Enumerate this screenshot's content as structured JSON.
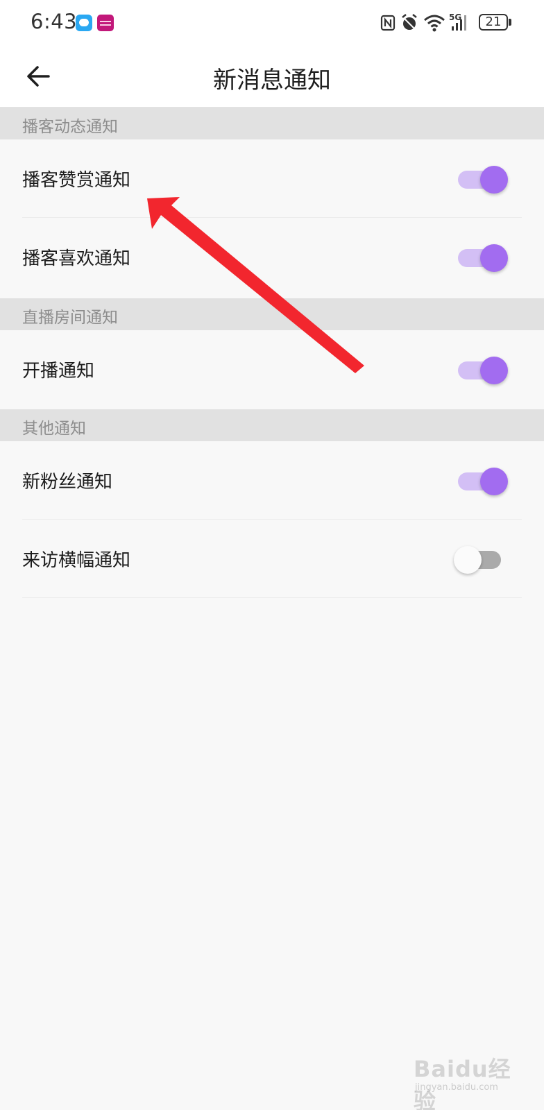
{
  "status_bar": {
    "time": "6:43",
    "network": "5G",
    "battery": "21"
  },
  "header": {
    "title": "新消息通知"
  },
  "sections": [
    {
      "title": "播客动态通知",
      "items": [
        {
          "label": "播客赞赏通知",
          "enabled": true
        },
        {
          "label": "播客喜欢通知",
          "enabled": true
        }
      ]
    },
    {
      "title": "直播房间通知",
      "items": [
        {
          "label": "开播通知",
          "enabled": true
        }
      ]
    },
    {
      "title": "其他通知",
      "items": [
        {
          "label": "新粉丝通知",
          "enabled": true
        },
        {
          "label": "来访横幅通知",
          "enabled": false
        }
      ]
    }
  ],
  "colors": {
    "accent": "#a26cf0",
    "accent_track": "#d3bff5",
    "off_track": "#aaaaaa",
    "annotation_arrow": "#f2262e"
  },
  "watermark": {
    "text": "Baidu经验",
    "sub": "jingyan.baidu.com"
  }
}
